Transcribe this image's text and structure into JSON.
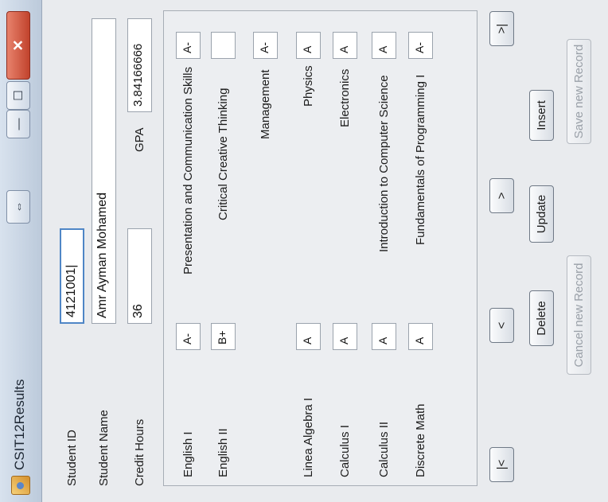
{
  "window": {
    "title": "CSIT12Results",
    "controls": {
      "restore": "⇔",
      "minimize": "—",
      "maximize": "☐",
      "close": "✕"
    }
  },
  "student": {
    "id_label": "Student ID",
    "id_value": "4121001|",
    "name_label": "Student Name",
    "name_value": "Amr Ayman Mohamed",
    "credit_label": "Credit Hours",
    "credit_value": "36",
    "gpa_label": "GPA",
    "gpa_value": "3.84166666"
  },
  "courses_left": [
    {
      "name": "English I",
      "grade": "A-"
    },
    {
      "name": "English II",
      "grade": "B+"
    },
    {
      "name": "Linea Algebra I",
      "grade": "A"
    },
    {
      "name": "Calculus I",
      "grade": "A"
    },
    {
      "name": "Calculus II",
      "grade": "A"
    },
    {
      "name": "Discrete Math",
      "grade": "A"
    }
  ],
  "courses_right": [
    {
      "name": "Presentation and Communication Skills",
      "grade": "A-"
    },
    {
      "name": "Critical Creative Thinking",
      "grade": ""
    },
    {
      "name": "Management",
      "grade": "A-"
    },
    {
      "name": "Physics",
      "grade": "A"
    },
    {
      "name": "Electronics",
      "grade": "A"
    },
    {
      "name": "Introduction to Computer Science",
      "grade": "A"
    },
    {
      "name": "Fundamentals of Programming I",
      "grade": "A-"
    }
  ],
  "nav": {
    "first": "|<",
    "prev": "<",
    "next": ">",
    "last": ">|"
  },
  "actions": {
    "delete": "Delete",
    "update": "Update",
    "insert": "Insert",
    "cancel_new": "Cancel new Record",
    "save_new": "Save new Record"
  }
}
